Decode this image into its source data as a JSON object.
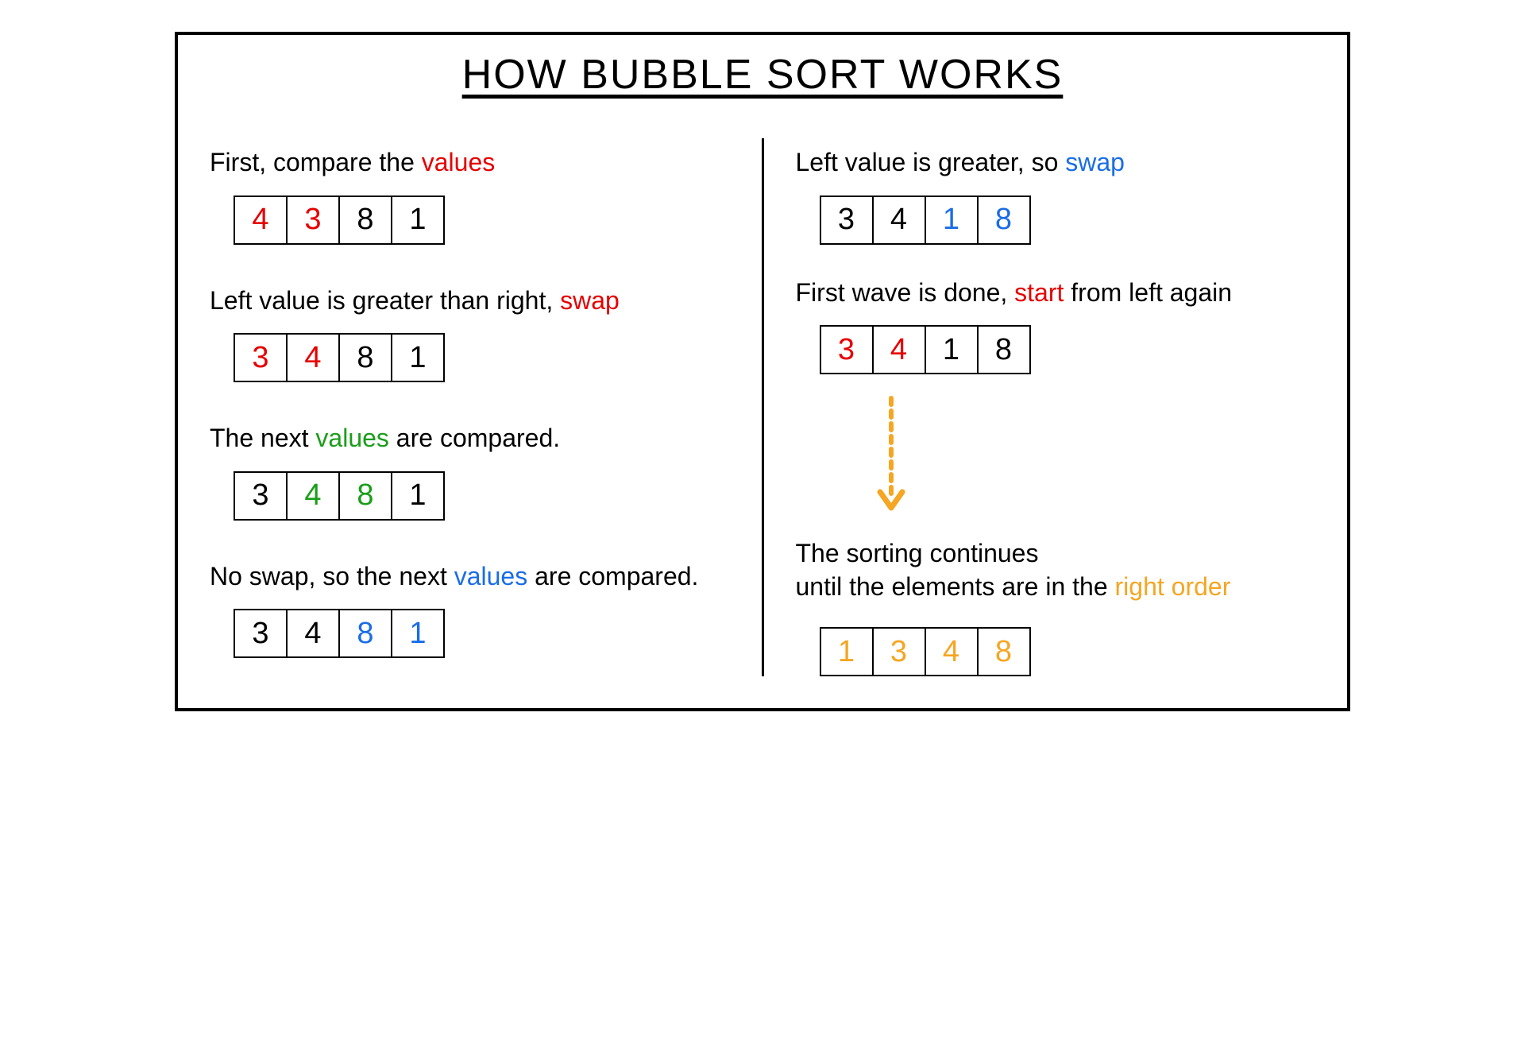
{
  "title": "HOW BUBBLE SORT WORKS",
  "colors": {
    "red": "#e60000",
    "green": "#1a9e1a",
    "blue": "#1a6de6",
    "orange": "#f5a623"
  },
  "left": {
    "step1": {
      "text_pre": "First, compare the ",
      "text_hl": "values",
      "hl_color": "red",
      "cells": [
        {
          "v": "4",
          "c": "red"
        },
        {
          "v": "3",
          "c": "red"
        },
        {
          "v": "8",
          "c": "black"
        },
        {
          "v": "1",
          "c": "black"
        }
      ]
    },
    "step2": {
      "text_pre": "Left value is greater than right, ",
      "text_hl": "swap",
      "hl_color": "red",
      "cells": [
        {
          "v": "3",
          "c": "red"
        },
        {
          "v": "4",
          "c": "red"
        },
        {
          "v": "8",
          "c": "black"
        },
        {
          "v": "1",
          "c": "black"
        }
      ]
    },
    "step3": {
      "text_pre": "The next ",
      "text_hl": "values",
      "text_post": " are compared.",
      "hl_color": "green",
      "cells": [
        {
          "v": "3",
          "c": "black"
        },
        {
          "v": "4",
          "c": "green"
        },
        {
          "v": "8",
          "c": "green"
        },
        {
          "v": "1",
          "c": "black"
        }
      ]
    },
    "step4": {
      "text_pre": "No swap, so the next ",
      "text_hl": "values",
      "text_post": " are compared.",
      "hl_color": "blue",
      "cells": [
        {
          "v": "3",
          "c": "black"
        },
        {
          "v": "4",
          "c": "black"
        },
        {
          "v": "8",
          "c": "blue"
        },
        {
          "v": "1",
          "c": "blue"
        }
      ]
    }
  },
  "right": {
    "step1": {
      "text_pre": "Left value is greater, so ",
      "text_hl": "swap",
      "hl_color": "blue",
      "cells": [
        {
          "v": "3",
          "c": "black"
        },
        {
          "v": "4",
          "c": "black"
        },
        {
          "v": "1",
          "c": "blue"
        },
        {
          "v": "8",
          "c": "blue"
        }
      ]
    },
    "step2": {
      "text_pre": "First wave is done, ",
      "text_hl": "start",
      "text_post": " from left again",
      "hl_color": "red",
      "cells": [
        {
          "v": "3",
          "c": "red"
        },
        {
          "v": "4",
          "c": "red"
        },
        {
          "v": "1",
          "c": "black"
        },
        {
          "v": "8",
          "c": "black"
        }
      ]
    },
    "step3": {
      "text_line1": "The sorting continues",
      "text_pre": "until the elements are in the ",
      "text_hl": "right order",
      "hl_color": "orange",
      "cells": [
        {
          "v": "1",
          "c": "orange"
        },
        {
          "v": "3",
          "c": "orange"
        },
        {
          "v": "4",
          "c": "orange"
        },
        {
          "v": "8",
          "c": "orange"
        }
      ]
    }
  }
}
